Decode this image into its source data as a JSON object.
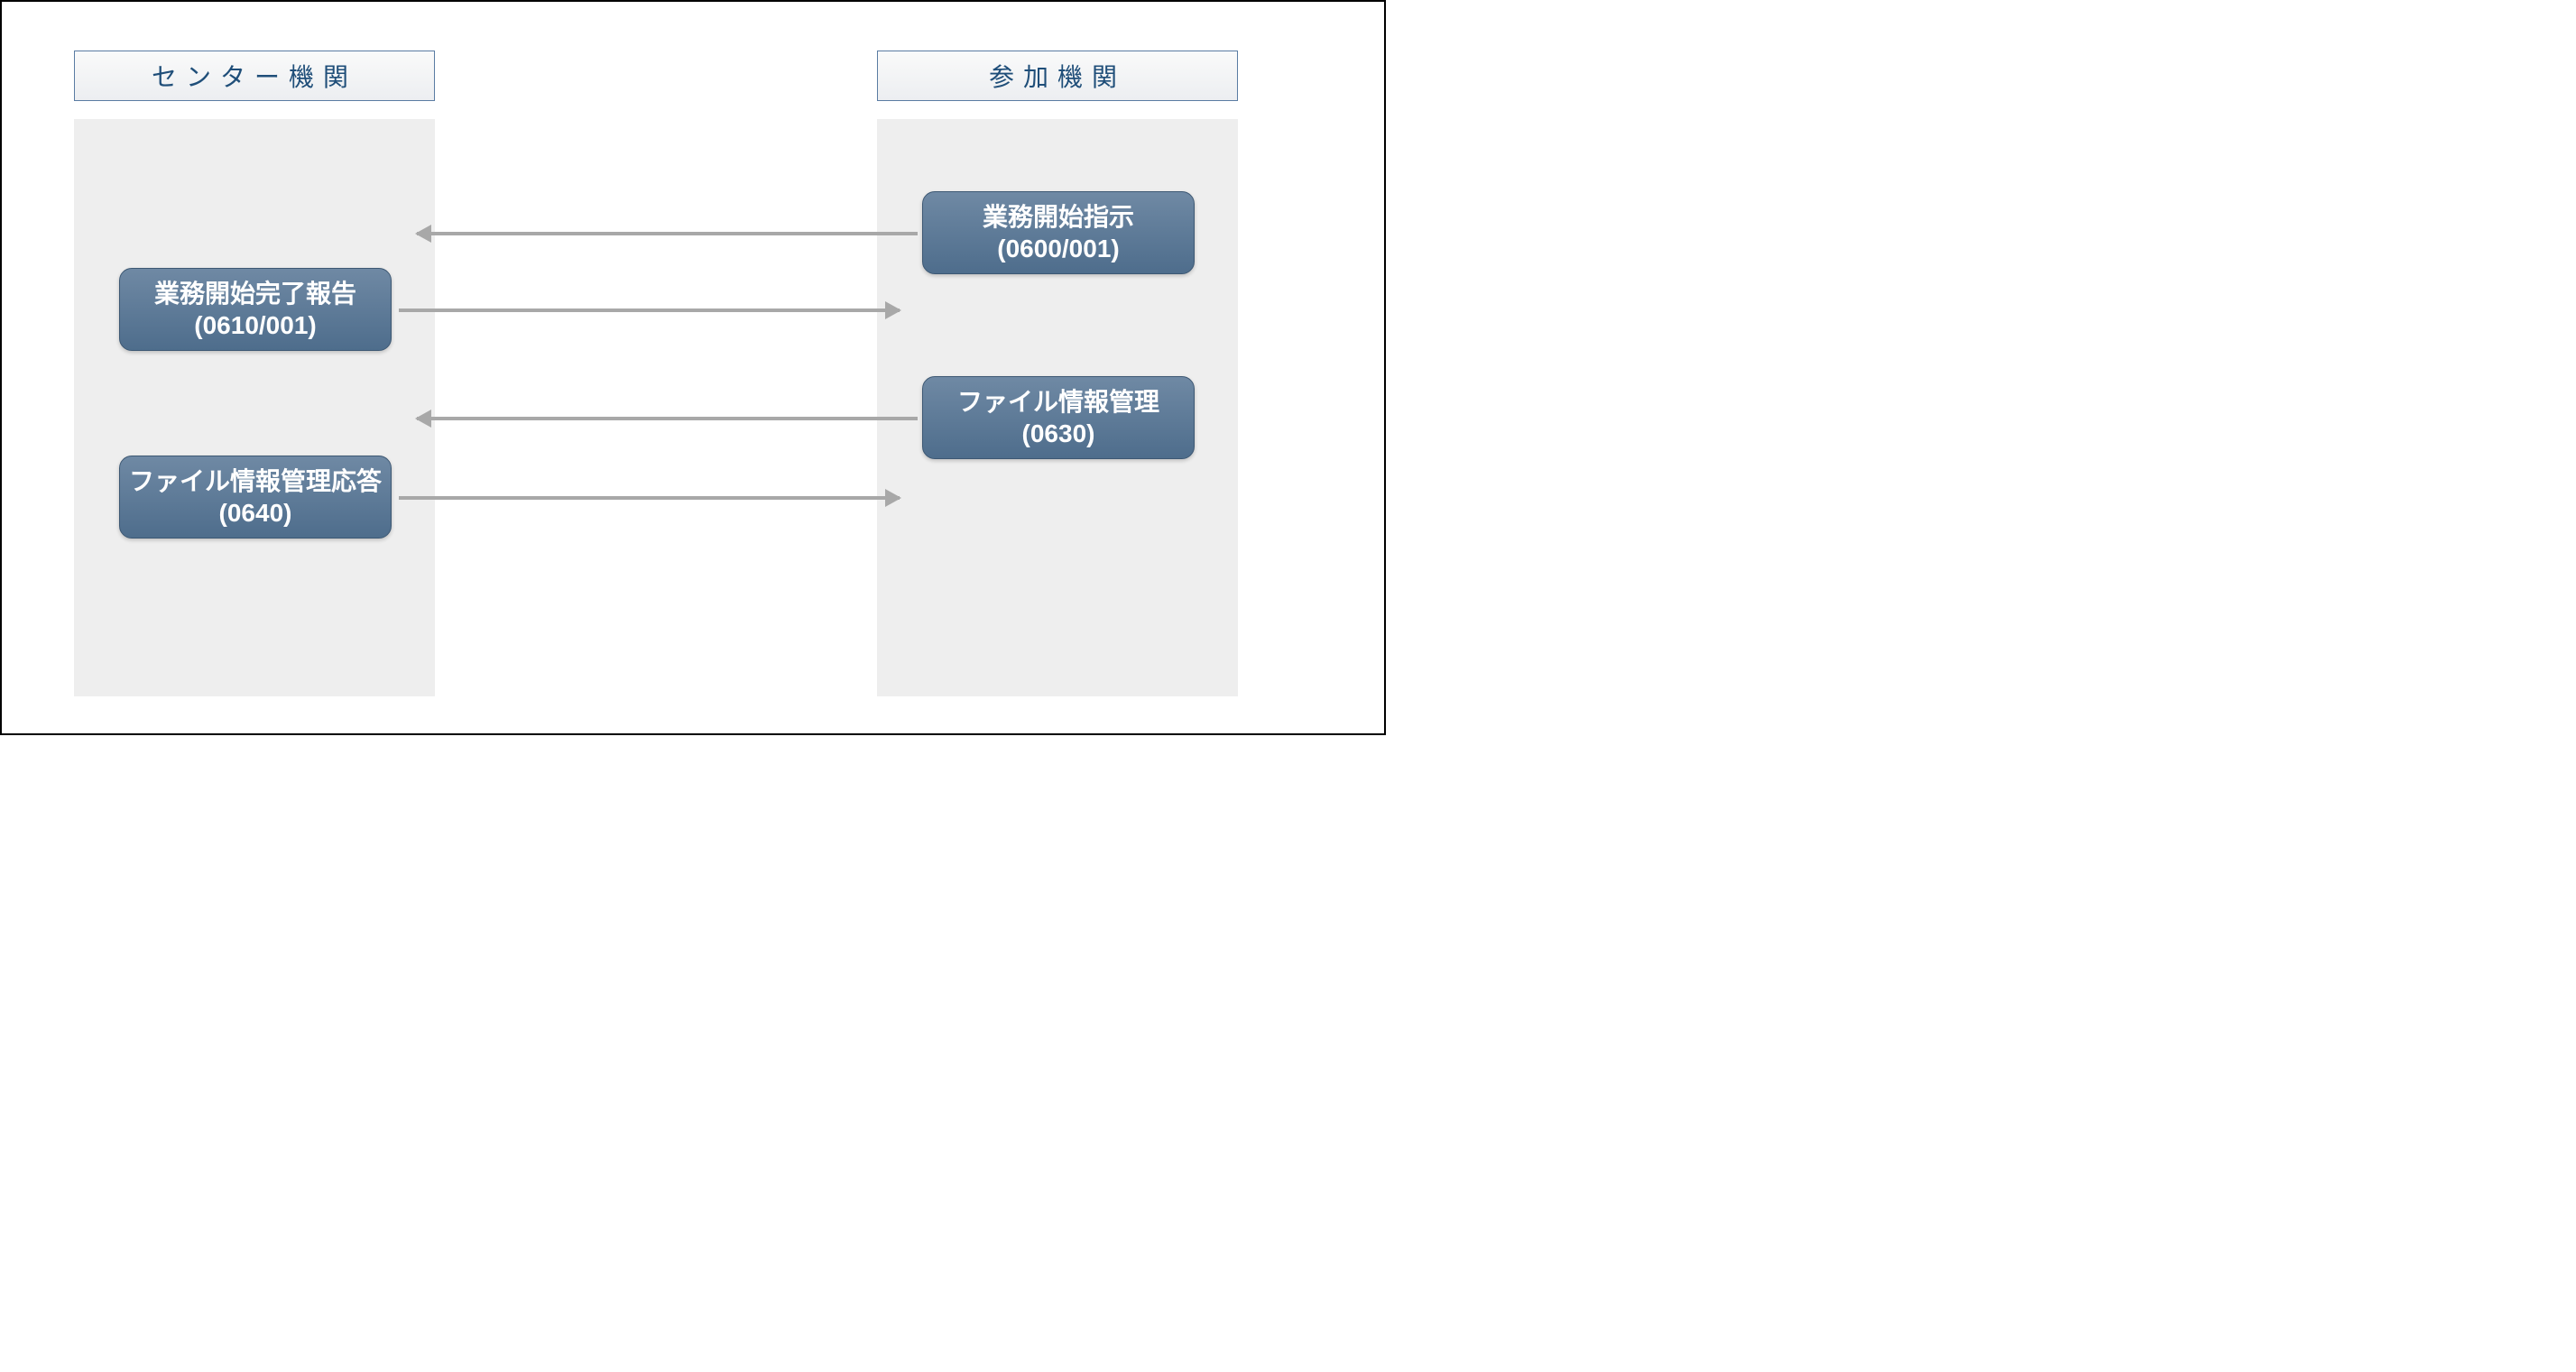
{
  "lanes": {
    "left": {
      "title": "センター機関"
    },
    "right": {
      "title": "参加機関"
    }
  },
  "messages": {
    "m1": {
      "line1": "業務開始指示",
      "line2": "(0600/001)"
    },
    "m2": {
      "line1": "業務開始完了報告",
      "line2": "(0610/001)"
    },
    "m3": {
      "line1": "ファイル情報管理",
      "line2": "(0630)"
    },
    "m4": {
      "line1": "ファイル情報管理応答",
      "line2": "(0640)"
    }
  }
}
